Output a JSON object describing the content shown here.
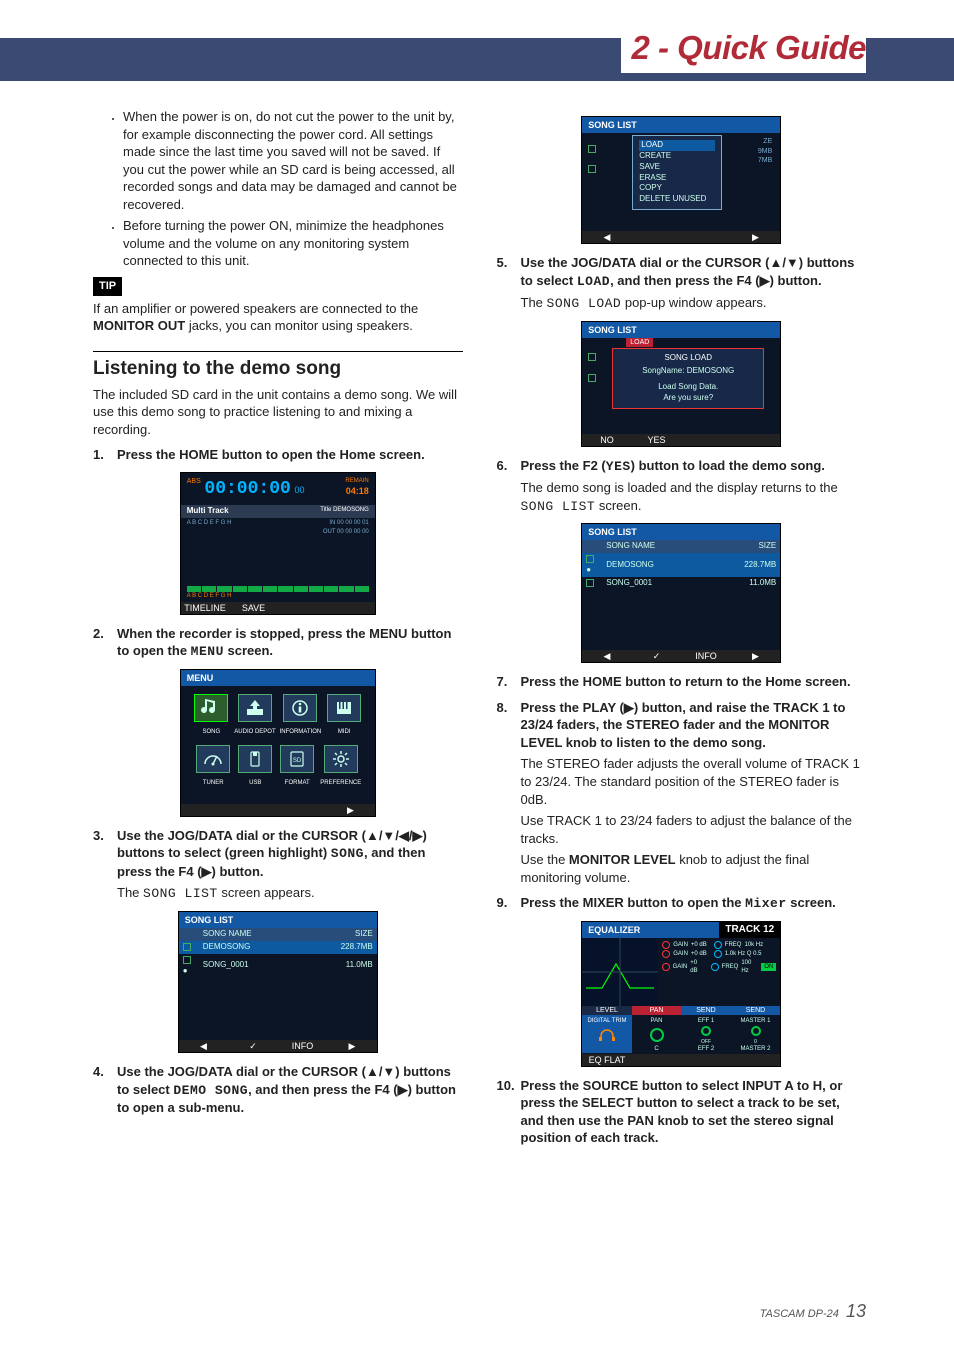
{
  "header": {
    "title": "2 - Quick Guide"
  },
  "left": {
    "bullets": [
      "When the power is on, do not cut the power to the unit by, for example disconnecting the power cord. All settings made since the last time you saved will not be saved. If you cut the power while an SD card is being accessed, all recorded songs and data may be damaged and cannot be recovered.",
      "Before turning the power ON, minimize the headphones volume and the volume on any monitoring system connected to this unit."
    ],
    "tip_label": "TIP",
    "tip_body_a": "If an amplifier or powered speakers are connected to the ",
    "tip_body_b": "MONITOR OUT",
    "tip_body_c": " jacks, you can monitor using speakers.",
    "section_title": " Listening to the demo song",
    "intro": "The included SD card in the unit contains a demo song. We will use this demo song to practice listening to and mixing a recording.",
    "steps": {
      "s1": {
        "num": "1.",
        "head": "Press the HOME button to open the Home screen."
      },
      "s2": {
        "num": "2.",
        "head_a": "When the recorder is stopped, press the MENU button to open the ",
        "head_mono": "MENU",
        "head_b": " screen."
      },
      "s3": {
        "num": "3.",
        "head_a": "Use the JOG/DATA dial or the CURSOR (▲/▼/◀/▶) buttons to select (green highlight) ",
        "head_mono": "SONG",
        "head_b": ", and then press the F4 (▶) button.",
        "sub_a": "The ",
        "sub_mono": "SONG LIST",
        "sub_b": " screen appears."
      },
      "s4": {
        "num": "4.",
        "head_a": "Use the JOG/DATA dial or the CURSOR (▲/▼) buttons to select ",
        "head_mono": "DEMO SONG",
        "head_b": ", and then press the F4 (▶) button to open a sub-menu."
      }
    },
    "home": {
      "header": "",
      "abs": "ABS",
      "time": "00:00:00",
      "ms": "00",
      "remain_lbl": "REMAIN",
      "remain_val": "04:18",
      "multitrack": "Multi Track",
      "title_lbl": "Title",
      "title_val": "DEMOSONG",
      "in_lbl": "IN",
      "in_val": "00 00 00 01",
      "out_lbl": "OUT",
      "out_val": "00 00 00 00",
      "letters": "A B C D E F G H",
      "foot1": "TIMELINE",
      "foot2": "SAVE"
    },
    "menu": {
      "header": "MENU",
      "items": [
        "SONG",
        "AUDIO DEPOT",
        "INFORMATION",
        "MIDI",
        "TUNER",
        "USB",
        "FORMAT",
        "PREFERENCE"
      ]
    },
    "songlist": {
      "header": "SONG LIST",
      "cols": [
        "",
        "SONG NAME",
        "SIZE"
      ],
      "rows": [
        {
          "sel": "",
          "name": "DEMOSONG",
          "size": "228.7MB"
        },
        {
          "sel": "●",
          "name": "SONG_0001",
          "size": "11.0MB"
        }
      ],
      "foot": [
        "◀",
        "✓",
        "INFO",
        "▶"
      ]
    }
  },
  "right": {
    "submenu": {
      "header": "SONG LIST",
      "items": [
        "LOAD",
        "CREATE",
        "SAVE",
        "ERASE",
        "COPY",
        "DELETE UNUSED"
      ],
      "side": [
        "ZE",
        "9MB",
        "7MB"
      ]
    },
    "s5": {
      "num": "5.",
      "head_a": "Use the JOG/DATA dial or the CURSOR (▲/▼) buttons to select ",
      "head_mono": "LOAD",
      "head_b": ", and then press the F4 (▶) button.",
      "sub_a": "The ",
      "sub_mono": "SONG LOAD",
      "sub_b": " pop-up window appears."
    },
    "loadpopup": {
      "header": "SONG LIST",
      "tag": "LOAD",
      "title": "SONG LOAD",
      "name_lbl": "SongName:",
      "name_val": "DEMOSONG",
      "l1": "Load Song Data.",
      "l2": "Are you sure?",
      "no": "NO",
      "yes": "YES"
    },
    "s6": {
      "num": "6.",
      "head_a": "Press the F2 (",
      "head_mono": "YES",
      "head_b": ") button to load the demo song.",
      "sub_a": "The demo song is loaded and the display returns to the ",
      "sub_mono": "SONG LIST",
      "sub_b": " screen."
    },
    "songlist2": {
      "header": "SONG LIST",
      "cols": [
        "",
        "SONG NAME",
        "SIZE"
      ],
      "rows": [
        {
          "sel": "●",
          "name": "DEMOSONG",
          "size": "228.7MB"
        },
        {
          "sel": "",
          "name": "SONG_0001",
          "size": "11.0MB"
        }
      ],
      "foot": [
        "◀",
        "✓",
        "INFO",
        "▶"
      ]
    },
    "s7": {
      "num": "7.",
      "head": "Press the HOME button to return to the Home screen."
    },
    "s8": {
      "num": "8.",
      "head": "Press the PLAY (▶) button, and raise the TRACK 1 to 23/24 faders, the STEREO fader and the MONITOR LEVEL knob to listen to the demo song.",
      "sub1": "The STEREO fader adjusts the overall volume of TRACK 1  to  23/24. The standard position of the STEREO fader is 0dB.",
      "sub2": "Use TRACK 1 to 23/24 faders to adjust the balance of the tracks.",
      "sub3_a": "Use the ",
      "sub3_b": "MONITOR LEVEL",
      "sub3_c": " knob to adjust the final monitoring volume."
    },
    "s9": {
      "num": "9.",
      "head_a": "Press the MIXER button to open the ",
      "head_mono": "Mixer",
      "head_b": " screen."
    },
    "mixer": {
      "header": "EQUALIZER",
      "track": "TRACK 12",
      "labels": [
        "LEVEL",
        "PAN",
        "SEND",
        "SEND"
      ],
      "bottom": "EQ FLAT",
      "digitrim": "DIGITAL TRIM",
      "eff1": "EFF 1",
      "eff2": "EFF 2",
      "m1": "MASTER 1",
      "m2": "MASTER 2",
      "gain": "GAIN",
      "freq": "FREQ",
      "on": "ON"
    },
    "s10": {
      "num": "10.",
      "head": "Press the SOURCE button to select INPUT A to H, or press the SELECT button to select a track to be set, and then use the PAN knob to set the stereo signal position of each track."
    }
  },
  "footer": {
    "brand": "TASCAM DP-24",
    "page": "13"
  }
}
